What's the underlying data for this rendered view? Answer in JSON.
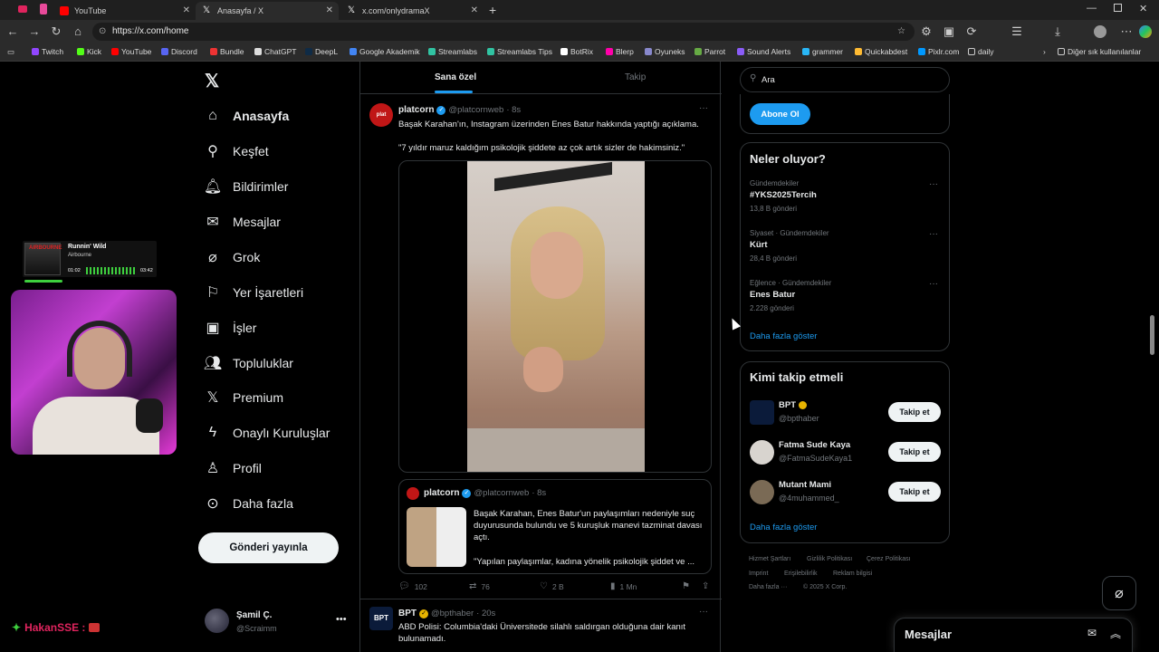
{
  "browser": {
    "tabs": [
      {
        "label": "YouTube"
      },
      {
        "label": "Anasayfa / X"
      },
      {
        "label": "x.com/onlydramaX"
      }
    ],
    "url": "https://x.com/home",
    "bookmarks": [
      "Twitch",
      "Kick",
      "YouTube",
      "Discord",
      "Bundle",
      "ChatGPT",
      "DeepL",
      "Google Akademik",
      "Streamlabs",
      "Streamlabs Tips",
      "BotRix",
      "Blerp",
      "Oyuneks",
      "Parrot",
      "Sound Alerts",
      "grammer",
      "Quickabdest",
      "Pixlr.com",
      "daily"
    ],
    "bookmarks_other": "Diğer sık kullanılanlar"
  },
  "overlay": {
    "song_title": "Runnin' Wild",
    "song_artist": "Airbourne",
    "time_elapsed": "01:02",
    "time_total": "03:42",
    "streamer_name": "HakanSSE :"
  },
  "nav": {
    "items": [
      {
        "label": "Anasayfa",
        "icon": "home-icon"
      },
      {
        "label": "Keşfet",
        "icon": "search-icon"
      },
      {
        "label": "Bildirimler",
        "icon": "bell-icon"
      },
      {
        "label": "Mesajlar",
        "icon": "mail-icon"
      },
      {
        "label": "Grok",
        "icon": "grok-icon"
      },
      {
        "label": "Yer İşaretleri",
        "icon": "bookmark-icon"
      },
      {
        "label": "İşler",
        "icon": "briefcase-icon"
      },
      {
        "label": "Topluluklar",
        "icon": "people-icon"
      },
      {
        "label": "Premium",
        "icon": "x-logo-icon"
      },
      {
        "label": "Onaylı Kuruluşlar",
        "icon": "lightning-icon"
      },
      {
        "label": "Profil",
        "icon": "person-icon"
      },
      {
        "label": "Daha fazla",
        "icon": "more-circle-icon"
      }
    ],
    "post_button": "Gönderi yayınla",
    "account_name": "Şamil Ç.",
    "account_handle": "@Scraimm"
  },
  "feed": {
    "tabs": [
      "Sana özel",
      "Takip"
    ],
    "tweet1": {
      "name": "platcorn",
      "handle": "@platcornweb",
      "time": "· 8s",
      "text1": "Başak Karahan'ın, Instagram üzerinden Enes Batur hakkında yaptığı açıklama.",
      "text2": "\"7 yıldır maruz kaldığım psikolojik şiddete az çok artık sizler de hakimsiniz.\"",
      "quote": {
        "name": "platcorn",
        "handle": "@platcornweb",
        "time": "· 8s",
        "text1": "Başak Karahan, Enes Batur'un paylaşımları nedeniyle suç duyurusunda bulundu ve 5 kuruşluk manevi tazminat davası açtı.",
        "text2": "\"Yapılan paylaşımlar, kadına yönelik psikolojik şiddet ve ..."
      },
      "replies": "102",
      "retweets": "76",
      "likes": "2 B",
      "views": "1 Mn"
    },
    "tweet2": {
      "name": "BPT",
      "handle": "@bpthaber",
      "time": "· 20s",
      "text": "ABD Polisi: Columbia'daki Üniversitede silahlı saldırgan olduğuna dair kanıt bulunamadı."
    }
  },
  "sidebar": {
    "search_placeholder": "Ara",
    "subscribe_button": "Abone Ol",
    "trends_title": "Neler oluyor?",
    "trends": [
      {
        "category": "Gündemdekiler",
        "name": "#YKS2025Tercih",
        "count": "13,8 B gönderi"
      },
      {
        "category": "Siyaset · Gündemdekiler",
        "name": "Kürt",
        "count": "28,4 B gönderi"
      },
      {
        "category": "Eğlence · Gündemdekiler",
        "name": "Enes Batur",
        "count": "2.228 gönderi"
      }
    ],
    "trends_more": "Daha fazla göster",
    "follow_title": "Kimi takip etmeli",
    "suggestions": [
      {
        "name": "BPT",
        "handle": "@bpthaber",
        "button": "Takip et"
      },
      {
        "name": "Fatma Sude Kaya",
        "handle": "@FatmaSudeKaya1",
        "button": "Takip et"
      },
      {
        "name": "Mutant Mami",
        "handle": "@4muhammed_",
        "button": "Takip et"
      }
    ],
    "follow_more": "Daha fazla göster",
    "footer_links": [
      "Hizmet Şartları",
      "Gizlilik Politikası",
      "Çerez Politikası",
      "Imprint",
      "Erişilebilirlik",
      "Reklam bilgisi",
      "Daha fazla ···",
      "© 2025 X Corp."
    ],
    "messages_title": "Mesajlar"
  },
  "colors": {
    "accent": "#1d9bf0",
    "background": "#000000",
    "border": "#2f3336"
  }
}
